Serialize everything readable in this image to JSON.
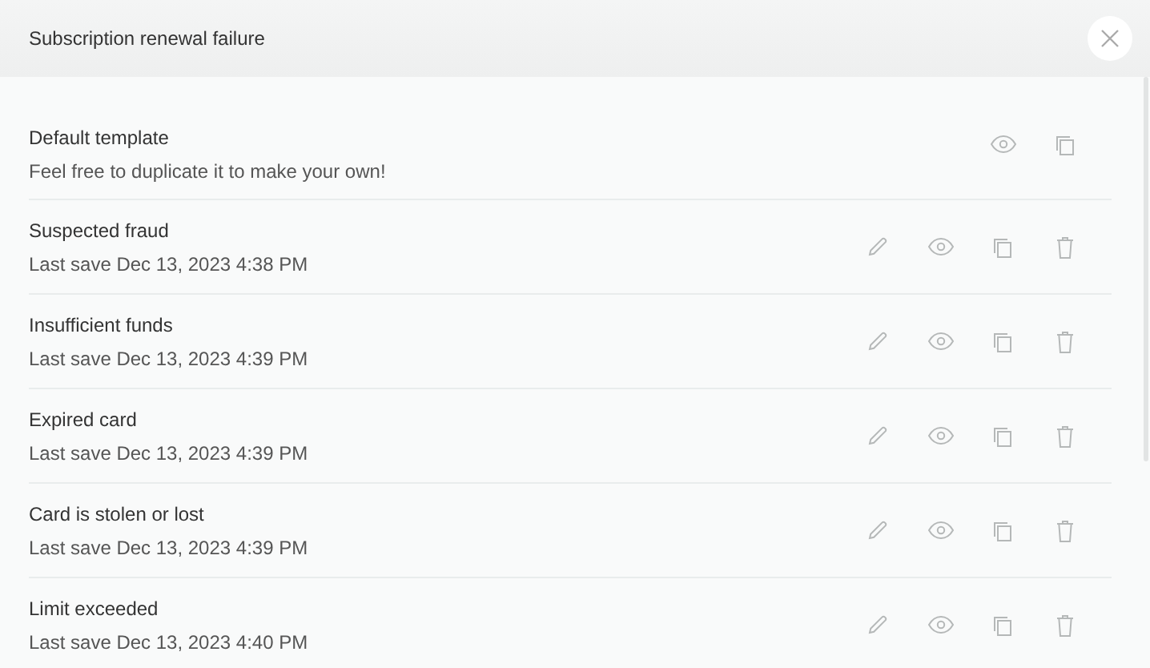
{
  "dialog": {
    "title": "Subscription renewal failure"
  },
  "templates": [
    {
      "name": "Default template",
      "detail": "Feel free to duplicate it to make your own!",
      "editable": false
    },
    {
      "name": "Suspected fraud",
      "detail": "Last save Dec 13, 2023 4:38 PM",
      "editable": true
    },
    {
      "name": "Insufficient funds",
      "detail": "Last save Dec 13, 2023 4:39 PM",
      "editable": true
    },
    {
      "name": "Expired card",
      "detail": "Last save Dec 13, 2023 4:39 PM",
      "editable": true
    },
    {
      "name": "Card is stolen or lost",
      "detail": "Last save Dec 13, 2023 4:39 PM",
      "editable": true
    },
    {
      "name": "Limit exceeded",
      "detail": "Last save Dec 13, 2023 4:40 PM",
      "editable": true
    }
  ]
}
